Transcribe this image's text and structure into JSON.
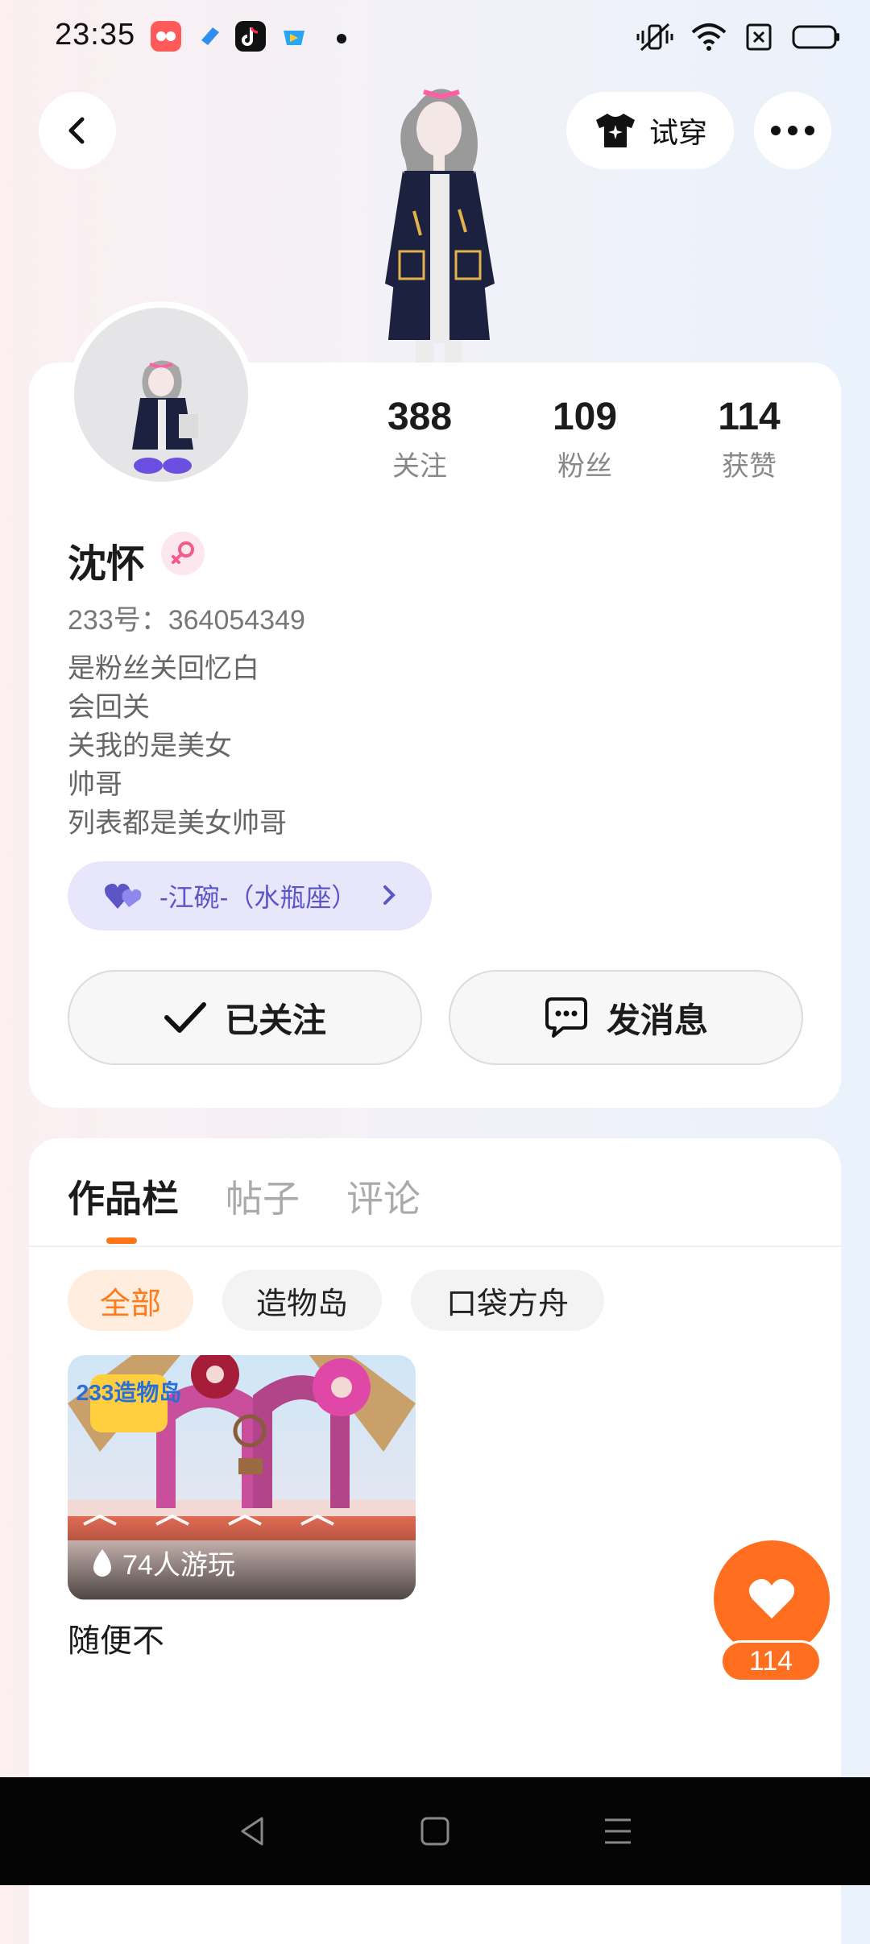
{
  "status_bar": {
    "time": "23:35",
    "app_icons": [
      "app-icon-pink",
      "app-icon-blue",
      "tiktok-icon",
      "app-icon-video"
    ],
    "system_icons": [
      "vibrate-icon",
      "wifi-icon",
      "sim-off-icon",
      "battery-icon"
    ]
  },
  "header": {
    "back_icon": "back-arrow-icon",
    "try_on_label": "试穿",
    "more_icon": "more-dots-icon"
  },
  "profile": {
    "stats": [
      {
        "value": "388",
        "label": "关注"
      },
      {
        "value": "109",
        "label": "粉丝"
      },
      {
        "value": "114",
        "label": "获赞"
      }
    ],
    "nickname": "沈怀",
    "gender": "female",
    "uid": "233号：364054349",
    "bio": [
      "是粉丝关回忆白",
      "会回关",
      "关我的是美女",
      "帅哥",
      "列表都是美女帅哥"
    ],
    "friend_tag": "-江碗-（水瓶座）",
    "follow_label": "已关注",
    "message_label": "发消息"
  },
  "works": {
    "tabs": [
      {
        "label": "作品栏",
        "active": true
      },
      {
        "label": "帖子",
        "active": false
      },
      {
        "label": "评论",
        "active": false
      }
    ],
    "chips": [
      {
        "label": "全部",
        "active": true
      },
      {
        "label": "造物岛",
        "active": false
      },
      {
        "label": "口袋方舟",
        "active": false
      }
    ],
    "items": [
      {
        "logo_text": "233造物岛",
        "plays": "74人游玩",
        "title": "随便不"
      }
    ]
  },
  "likes": {
    "count": "114"
  },
  "colors": {
    "accent": "#ff6f1f",
    "friend_tag_text": "#5b55c6",
    "friend_tag_bg": "#e8e6fb"
  }
}
